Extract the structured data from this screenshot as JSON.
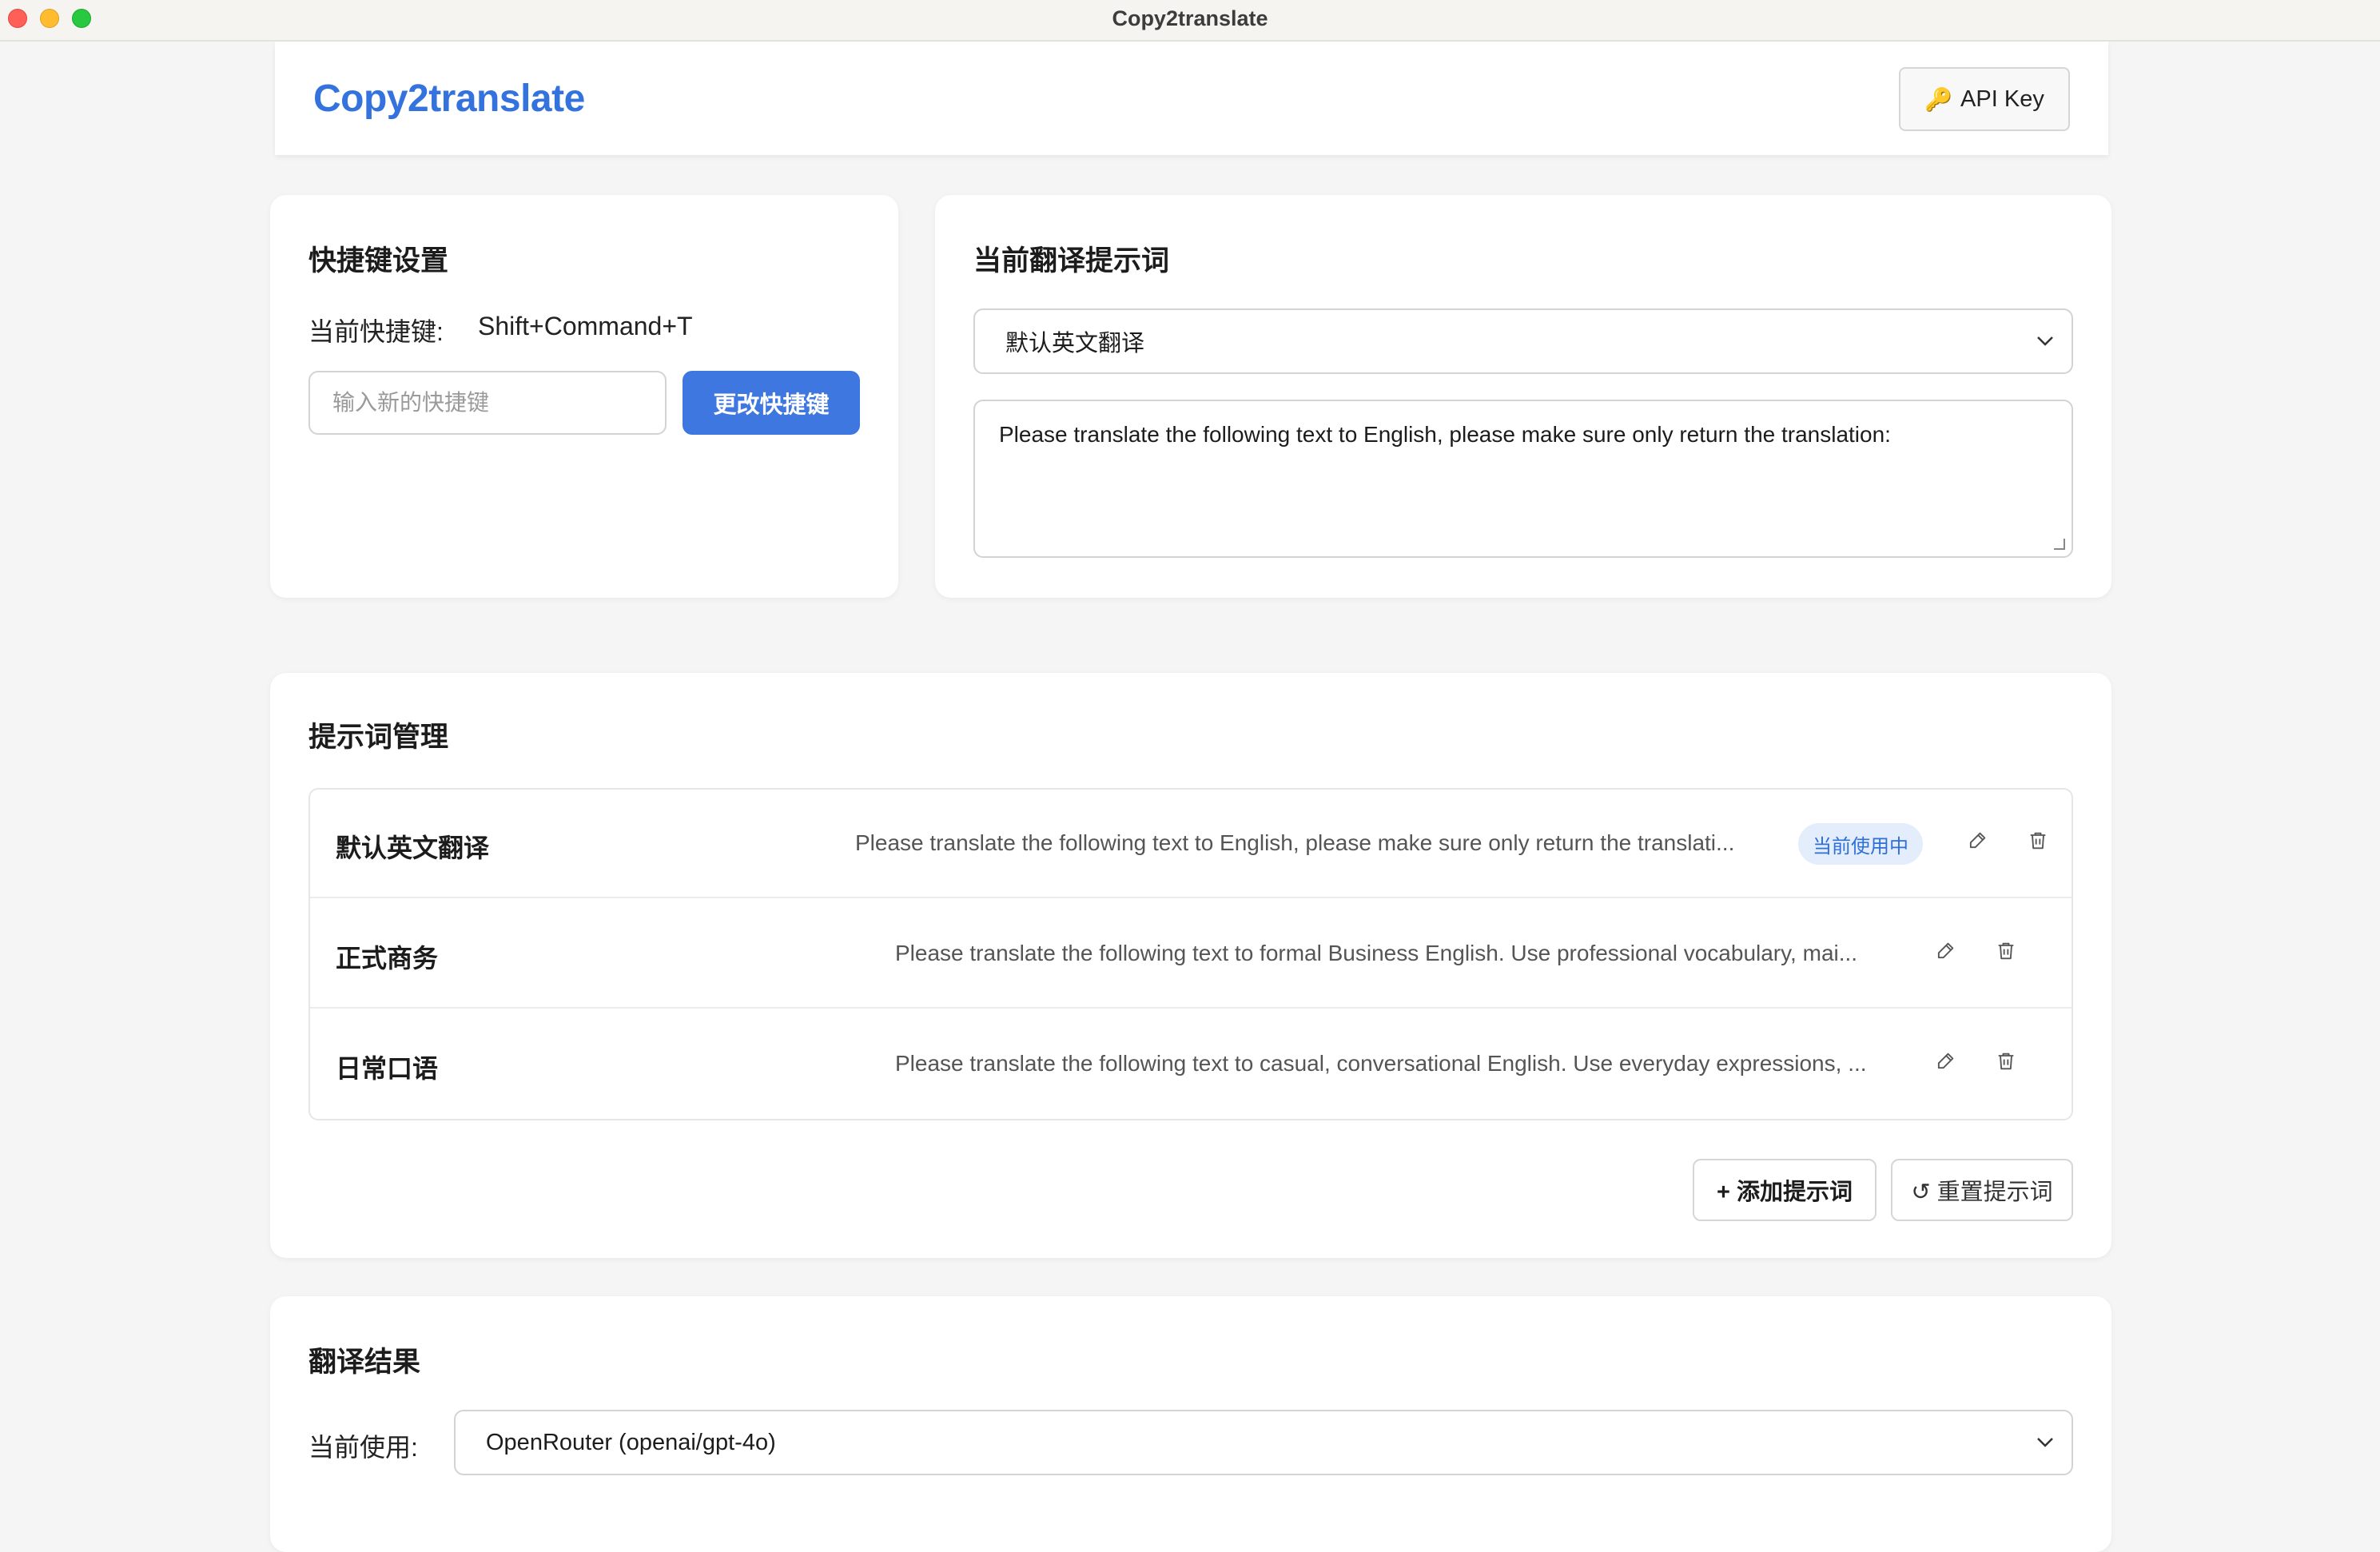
{
  "window": {
    "title": "Copy2translate"
  },
  "header": {
    "logo": "Copy2translate",
    "api_key_label": "API Key",
    "api_key_icon": "🔑"
  },
  "shortcut": {
    "title": "快捷键设置",
    "current_label": "当前快捷键:",
    "current_value": "Shift+Command+T",
    "input_placeholder": "输入新的快捷键",
    "change_button": "更改快捷键"
  },
  "current_prompt": {
    "title": "当前翻译提示词",
    "selected": "默认英文翻译",
    "text": "Please translate the following text to English, please make sure only return the translation:"
  },
  "prompt_manage": {
    "title": "提示词管理",
    "items": [
      {
        "name": "默认英文翻译",
        "text": "Please translate the following text to English, please make sure only return the translati...",
        "badge": "当前使用中"
      },
      {
        "name": "正式商务",
        "text": "Please translate the following text to formal Business English. Use professional vocabulary, mai..."
      },
      {
        "name": "日常口语",
        "text": "Please translate the following text to casual, conversational English. Use everyday expressions, ..."
      }
    ],
    "add_button": "+ 添加提示词",
    "reset_button": "↺ 重置提示词"
  },
  "result": {
    "title": "翻译结果",
    "model_label": "当前使用:",
    "model_selected": "OpenRouter (openai/gpt-4o)"
  },
  "colors": {
    "accent": "#3d77df",
    "logo": "#3473dd",
    "badge_bg": "#e3edfb",
    "badge_text": "#2f6fd8"
  }
}
